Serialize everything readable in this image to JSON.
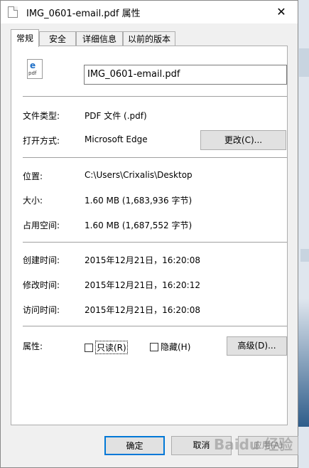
{
  "window": {
    "title": "IMG_0601-email.pdf 属性",
    "close_label": "✕"
  },
  "tabs": [
    {
      "label": "常规"
    },
    {
      "label": "安全"
    },
    {
      "label": "详细信息"
    },
    {
      "label": "以前的版本"
    }
  ],
  "file": {
    "icon_glyph": "e",
    "icon_ext": "pdf",
    "name": "IMG_0601-email.pdf"
  },
  "general": {
    "type_label": "文件类型:",
    "type_value": "PDF 文件 (.pdf)",
    "opens_label": "打开方式:",
    "opens_value": "Microsoft Edge",
    "change_button": "更改(C)...",
    "location_label": "位置:",
    "location_value": "C:\\Users\\Crixalis\\Desktop",
    "size_label": "大小:",
    "size_value": "1.60 MB (1,683,936 字节)",
    "disk_label": "占用空间:",
    "disk_value": "1.60 MB (1,687,552 字节)",
    "created_label": "创建时间:",
    "created_value": "2015年12月21日，16:20:08",
    "modified_label": "修改时间:",
    "modified_value": "2015年12月21日，16:20:12",
    "accessed_label": "访问时间:",
    "accessed_value": "2015年12月21日，16:20:08",
    "attrs_label": "属性:",
    "readonly_label": "只读(R)",
    "hidden_label": "隐藏(H)",
    "advanced_button": "高级(D)..."
  },
  "footer": {
    "ok": "确定",
    "cancel": "取消",
    "apply": "应用(A)"
  },
  "watermark": "Baidu 经验"
}
